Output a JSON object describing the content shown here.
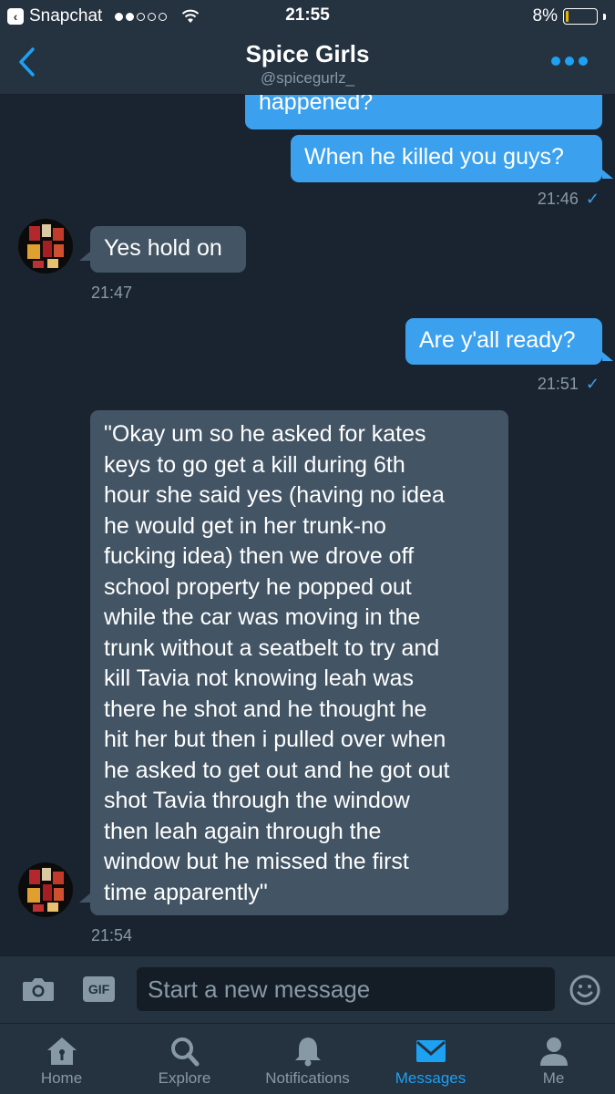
{
  "status_bar": {
    "back_app": "Snapchat",
    "time": "21:55",
    "battery_percent": "8%",
    "battery_level": 0.08,
    "signal_bars_filled": 2,
    "signal_bars_total": 5
  },
  "header": {
    "title": "Spice Girls",
    "handle": "@spicegurlz_"
  },
  "messages": [
    {
      "side": "out",
      "text": "happened?"
    },
    {
      "side": "out",
      "text": "When he killed you guys?",
      "time": "21:46",
      "check": "✓"
    },
    {
      "side": "in",
      "text": "Yes hold on",
      "time": "21:47"
    },
    {
      "side": "out",
      "text": "Are y'all ready?",
      "time": "21:51",
      "check": "✓"
    },
    {
      "side": "in",
      "lines": [
        "\"Okay um so he asked for kates",
        "keys to go get a kill during 6th",
        "hour she said yes (having no idea",
        "he would get in her trunk-no",
        "fucking idea) then we drove off",
        "school property he popped out",
        "while the car was moving in the",
        "trunk without a seatbelt to try and",
        "kill Tavia not knowing leah was",
        "there he shot and he thought he",
        "hit her but then i pulled over when",
        "he asked to get out and he got out",
        "shot Tavia through the window",
        "then leah again through the",
        "window but he missed the first",
        "time apparently\""
      ],
      "time": "21:54"
    }
  ],
  "composer": {
    "placeholder": "Start a new message",
    "gif_label": "GIF"
  },
  "tabs": [
    {
      "label": "Home",
      "icon": "home-icon",
      "active": false
    },
    {
      "label": "Explore",
      "icon": "search-icon",
      "active": false
    },
    {
      "label": "Notifications",
      "icon": "bell-icon",
      "active": false
    },
    {
      "label": "Messages",
      "icon": "envelope-icon",
      "active": true
    },
    {
      "label": "Me",
      "icon": "person-icon",
      "active": false
    }
  ],
  "colors": {
    "background": "#1a2430",
    "bar": "#253240",
    "outgoing_bubble": "#3ba1ee",
    "incoming_bubble": "#435565",
    "accent": "#1da1f2",
    "muted_text": "#8899a6"
  }
}
